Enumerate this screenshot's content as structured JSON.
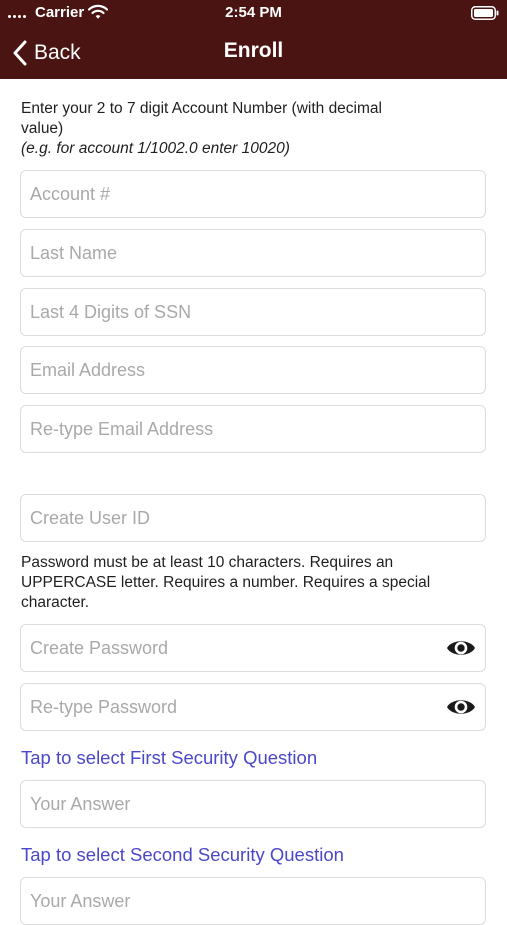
{
  "status_bar": {
    "carrier": "Carrier",
    "time": "2:54 PM",
    "signal_icon": "signal-dots-icon",
    "wifi_icon": "wifi-icon",
    "battery_icon": "battery-icon"
  },
  "nav": {
    "back_label": "Back",
    "title": "Enroll",
    "back_icon": "chevron-left-icon"
  },
  "form": {
    "account_instructions": "Enter your 2 to 7 digit Account Number (with decimal value)",
    "account_example": "(e.g. for account 1/1002.0 enter 10020)",
    "account_placeholder": "Account #",
    "last_name_placeholder": "Last Name",
    "ssn_placeholder": "Last 4 Digits of SSN",
    "email_placeholder": "Email Address",
    "email_confirm_placeholder": "Re-type Email Address",
    "user_id_placeholder": "Create User ID",
    "password_rules": "Password must be at least 10 characters. Requires an UPPERCASE letter. Requires a number. Requires a special character.",
    "password_placeholder": "Create Password",
    "password_confirm_placeholder": "Re-type Password",
    "first_question_link": "Tap to select First Security Question",
    "first_answer_placeholder": "Your Answer",
    "second_question_link": "Tap to select Second Security Question",
    "second_answer_placeholder": "Your Answer",
    "eye_icon": "eye-icon"
  },
  "colors": {
    "header_background": "#4a1412",
    "link": "#4b48c8",
    "field_border": "#dcdcdc",
    "placeholder": "#a9a9a9"
  }
}
